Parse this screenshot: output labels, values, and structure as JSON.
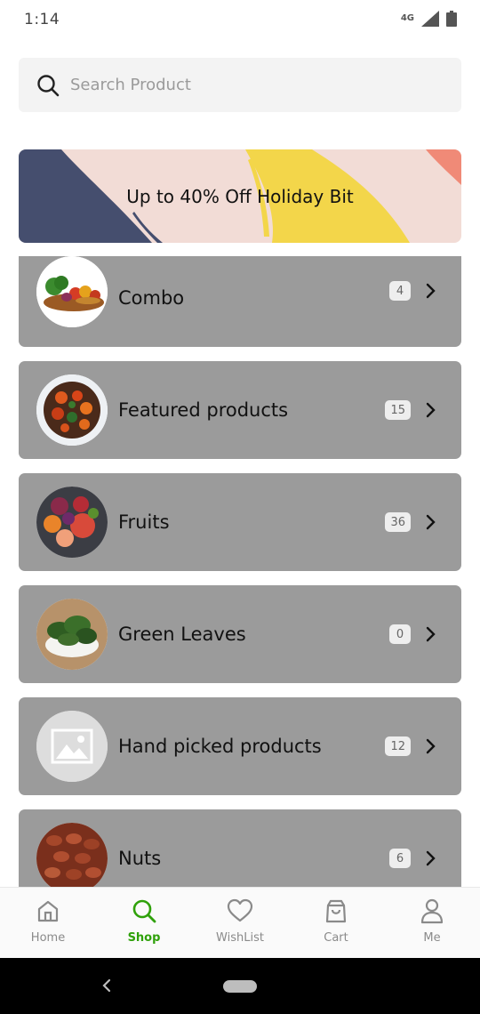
{
  "status_bar": {
    "time": "1:14",
    "network": "4G"
  },
  "search": {
    "placeholder": "Search Product",
    "value": ""
  },
  "banner": {
    "text": "Up to 40% Off Holiday Bit"
  },
  "categories": [
    {
      "name": "Combo",
      "count": "4",
      "image": "vegetable-basket-photo"
    },
    {
      "name": "Featured products",
      "count": "15",
      "image": "roasted-vegetables-photo"
    },
    {
      "name": "Fruits",
      "count": "36",
      "image": "mixed-fruits-photo"
    },
    {
      "name": "Green Leaves",
      "count": "0",
      "image": "leafy-greens-photo"
    },
    {
      "name": "Hand picked products",
      "count": "12",
      "image": "placeholder-image-icon"
    },
    {
      "name": "Nuts",
      "count": "6",
      "image": "pecan-nuts-photo"
    }
  ],
  "bottom_nav": {
    "items": [
      {
        "label": "Home",
        "icon": "home-icon",
        "active": false
      },
      {
        "label": "Shop",
        "icon": "search-icon",
        "active": true
      },
      {
        "label": "WishList",
        "icon": "heart-icon",
        "active": false
      },
      {
        "label": "Cart",
        "icon": "shopping-bag-icon",
        "active": false
      },
      {
        "label": "Me",
        "icon": "user-icon",
        "active": false
      }
    ]
  },
  "colors": {
    "accent": "#2fa10a",
    "card_background": "#9b9b9b",
    "banner_background": "#f2dcd6",
    "banner_navy": "#454e6e",
    "banner_yellow": "#f3d64a",
    "banner_coral": "#f08a77"
  }
}
